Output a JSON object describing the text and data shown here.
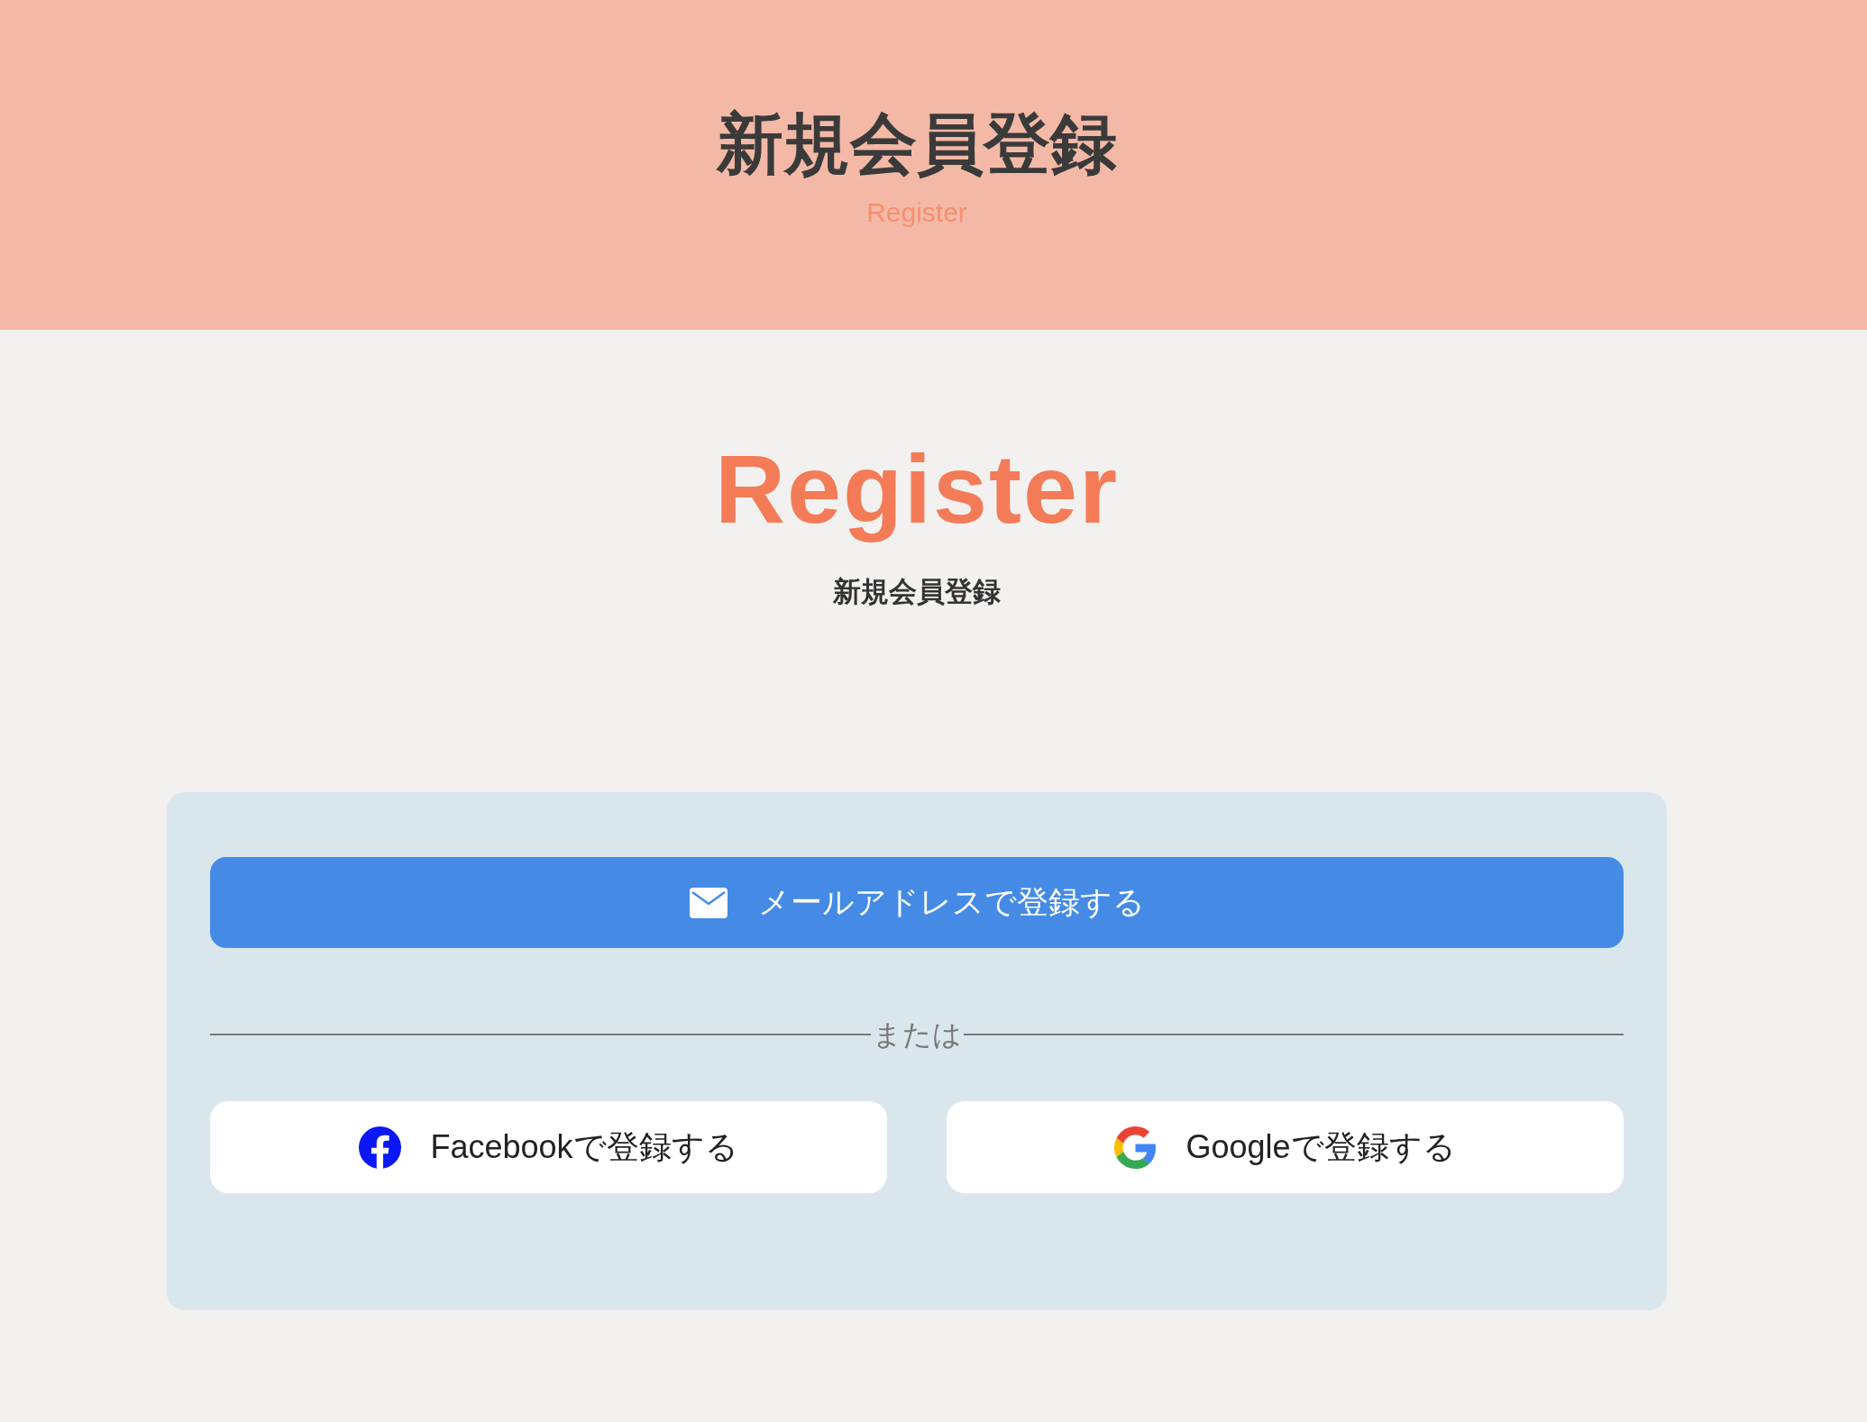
{
  "header": {
    "title": "新規会員登録",
    "subtitle": "Register"
  },
  "section": {
    "title": "Register",
    "subtitle": "新規会員登録"
  },
  "register_panel": {
    "email_button": {
      "label": "メールアドレスで登録する"
    },
    "divider": {
      "label": "または"
    },
    "social_buttons": [
      {
        "kind": "facebook",
        "label": "Facebookで登録する"
      },
      {
        "kind": "google",
        "label": "Googleで登録する"
      }
    ]
  }
}
